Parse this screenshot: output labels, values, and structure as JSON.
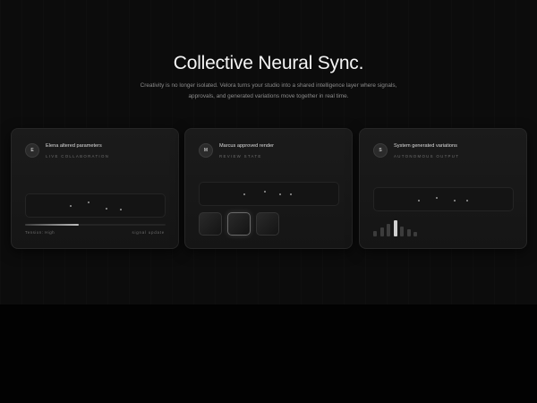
{
  "hero": {
    "title": "Collective Neural Sync.",
    "subtitle": "Creativity is no longer isolated. Velora turns your studio into a shared intelligence layer where signals, approvals, and generated variations move together in real time."
  },
  "cards": [
    {
      "avatar": "E",
      "title": "Elena altered parameters",
      "tag": "LIVE COLLABORATION",
      "meta_left": "Tension: High",
      "meta_right": "signal update",
      "progress": 0.38
    },
    {
      "avatar": "M",
      "title": "Marcus approved render",
      "tag": "REVIEW STATE",
      "selected_thumbnail": 2
    },
    {
      "avatar": "S",
      "title": "System generated variations",
      "tag": "AUTONOMOUS OUTPUT",
      "bar_levels": [
        0.35,
        0.55,
        0.75,
        1.0,
        0.6,
        0.45,
        0.3
      ],
      "peak_bar": 4
    }
  ]
}
